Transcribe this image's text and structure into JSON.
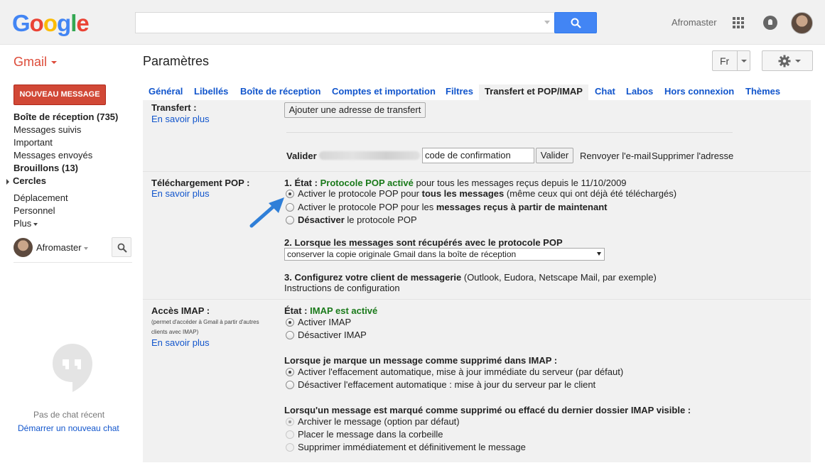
{
  "header": {
    "logo_text": "Google",
    "account_name": "Afromaster",
    "icons": [
      "search-icon",
      "apps-icon",
      "notifications-icon",
      "avatar"
    ]
  },
  "subheader": {
    "app_label": "Gmail",
    "page_title": "Paramètres",
    "language": "Fr"
  },
  "sidebar": {
    "compose_label": "NOUVEAU MESSAGE",
    "items": [
      {
        "label": "Boîte de réception (735)",
        "bold": true
      },
      {
        "label": "Messages suivis",
        "bold": false
      },
      {
        "label": "Important",
        "bold": false
      },
      {
        "label": "Messages envoyés",
        "bold": false
      },
      {
        "label": "Brouillons (13)",
        "bold": true
      },
      {
        "label": "Cercles",
        "bold": true
      },
      {
        "label": "Déplacement",
        "bold": false
      },
      {
        "label": "Personnel",
        "bold": false
      },
      {
        "label": "Plus",
        "bold": false
      }
    ],
    "hangouts_user": "Afromaster",
    "chat_empty": "Pas de chat récent",
    "chat_start": "Démarrer un nouveau chat"
  },
  "tabs": [
    {
      "label": "Général",
      "active": false
    },
    {
      "label": "Libellés",
      "active": false
    },
    {
      "label": "Boîte de réception",
      "active": false
    },
    {
      "label": "Comptes et importation",
      "active": false
    },
    {
      "label": "Filtres",
      "active": false
    },
    {
      "label": "Transfert et POP/IMAP",
      "active": true
    },
    {
      "label": "Chat",
      "active": false
    },
    {
      "label": "Labos",
      "active": false
    },
    {
      "label": "Hors connexion",
      "active": false
    },
    {
      "label": "Thèmes",
      "active": false
    }
  ],
  "forwarding": {
    "label": "Transfert :",
    "learn_more": "En savoir plus",
    "add_button": "Ajouter une adresse de transfert",
    "verify_label": "Valider",
    "code_value": "code de confirmation",
    "verify_button": "Valider",
    "resend_link": "Renvoyer l'e-mail",
    "remove_link": "Supprimer l'adresse"
  },
  "pop": {
    "label": "Téléchargement POP :",
    "learn_more": "En savoir plus",
    "status_prefix": "1. État :",
    "status_value": "Protocole POP activé",
    "status_suffix": "pour tous les messages reçus depuis le 11/10/2009",
    "options": [
      {
        "pre": "Activer le protocole POP pour ",
        "bold": "tous les messages",
        "post": " (même ceux qui ont déjà été téléchargés)",
        "checked": true
      },
      {
        "pre": "Activer le protocole POP pour les ",
        "bold": "messages reçus à partir de maintenant",
        "post": "",
        "checked": false
      },
      {
        "pre": "",
        "bold": "Désactiver",
        "post": " le protocole POP",
        "checked": false
      }
    ],
    "retrieve_heading": "2. Lorsque les messages sont récupérés avec le protocole POP",
    "retrieve_select": "conserver la copie originale Gmail dans la boîte de réception",
    "client_heading_bold": "3. Configurez votre client de messagerie",
    "client_heading_rest": " (Outlook, Eudora, Netscape Mail, par exemple)",
    "client_link": "Instructions de configuration"
  },
  "imap": {
    "label": "Accès IMAP :",
    "note": "(permet d'accéder à Gmail à partir d'autres clients avec IMAP)",
    "learn_more": "En savoir plus",
    "status_prefix": "État :",
    "status_value": "IMAP est activé",
    "options": [
      {
        "label": "Activer IMAP",
        "checked": true
      },
      {
        "label": "Désactiver IMAP",
        "checked": false
      }
    ],
    "delete_heading": "Lorsque je marque un message comme supprimé dans IMAP :",
    "delete_options": [
      {
        "label": "Activer l'effacement automatique, mise à jour immédiate du serveur (par défaut)",
        "checked": true
      },
      {
        "label": "Désactiver l'effacement automatique : mise à jour du serveur par le client",
        "checked": false
      }
    ],
    "expunge_heading": "Lorsqu'un message est marqué comme supprimé ou effacé du dernier dossier IMAP visible :",
    "expunge_options": [
      {
        "label": "Archiver le message (option par défaut)",
        "checked": true
      },
      {
        "label": "Placer le message dans la corbeille",
        "checked": false
      },
      {
        "label": "Supprimer immédiatement et définitivement le message",
        "checked": false
      }
    ]
  },
  "colors": {
    "accent_red": "#d14836",
    "link_blue": "#1155cc",
    "status_green": "#1a7a1a",
    "annotation_arrow": "#2f7fd8"
  }
}
